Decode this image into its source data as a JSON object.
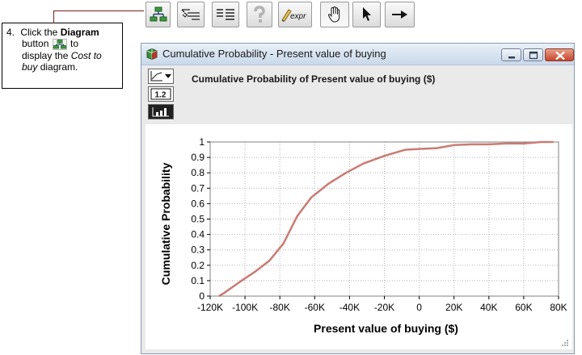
{
  "callout": {
    "step_number": "4.",
    "line1_pre": "Click the ",
    "line1_bold": "Diagram",
    "line2_pre": "button ",
    "line2_post": " to",
    "line3_pre": "display the ",
    "line3_italic": "Cost to",
    "line4_italic": "buy",
    "line4_post": " diagram."
  },
  "toolbar": {
    "buttons": [
      {
        "name": "diagram-button",
        "icon": "diagram-icon",
        "pressed": false
      },
      {
        "name": "outline-button",
        "icon": "outline-icon",
        "pressed": false
      },
      {
        "name": "attribute-panel-button",
        "icon": "attribute-list-icon",
        "pressed": false
      },
      {
        "name": "help-button",
        "icon": "question-icon",
        "pressed": false
      },
      {
        "name": "expression-button",
        "icon": "expr-pencil-icon",
        "label": "expr",
        "pressed": false
      },
      {
        "name": "browse-tool-button",
        "icon": "hand-icon",
        "pressed": true
      },
      {
        "name": "edit-tool-button",
        "icon": "arrow-pointer-icon",
        "pressed": false
      },
      {
        "name": "arrow-tool-button",
        "icon": "right-arrow-icon",
        "pressed": false
      }
    ]
  },
  "window": {
    "title": "Cumulative Probability - Present value of buying",
    "chart_heading": "Cumulative Probability of Present value of buying ($)",
    "side_tools": [
      {
        "name": "graph-type-dropdown",
        "icon": "graph-dropdown-icon"
      },
      {
        "name": "table-view-button",
        "icon": "table-1-2-icon",
        "label": "1.2"
      },
      {
        "name": "graph-view-button",
        "icon": "bar-graph-icon"
      }
    ]
  },
  "chart_data": {
    "type": "line",
    "xlabel": "Present value of buying ($)",
    "ylabel": "Cumulative Probability",
    "xlim": [
      -120000,
      80000
    ],
    "ylim": [
      0,
      1
    ],
    "x_ticks": [
      -120000,
      -100000,
      -80000,
      -60000,
      -40000,
      -20000,
      0,
      20000,
      40000,
      60000,
      80000
    ],
    "x_tick_labels": [
      "-120K",
      "-100K",
      "-80K",
      "-60K",
      "-40K",
      "-20K",
      "0",
      "20K",
      "40K",
      "60K",
      "80K"
    ],
    "y_ticks": [
      0,
      0.1,
      0.2,
      0.3,
      0.4,
      0.5,
      0.6,
      0.7,
      0.8,
      0.9,
      1
    ],
    "y_tick_labels": [
      "0",
      "0.1",
      "0.2",
      "0.3",
      "0.4",
      "0.5",
      "0.6",
      "0.7",
      "0.8",
      "0.9",
      "1"
    ],
    "grid": true,
    "line_color": "#c97b74",
    "series": [
      {
        "x": [
          -115000,
          -112000,
          -102000,
          -94000,
          -86000,
          -78000,
          -70000,
          -62000,
          -52000,
          -42000,
          -32000,
          -20000,
          -8000,
          0,
          10000,
          20000,
          30000,
          40000,
          50000,
          60000,
          70000,
          77000
        ],
        "y": [
          0,
          0.02,
          0.1,
          0.16,
          0.23,
          0.34,
          0.52,
          0.64,
          0.73,
          0.8,
          0.86,
          0.91,
          0.95,
          0.955,
          0.96,
          0.98,
          0.985,
          0.985,
          0.99,
          0.99,
          1,
          1
        ]
      }
    ]
  }
}
